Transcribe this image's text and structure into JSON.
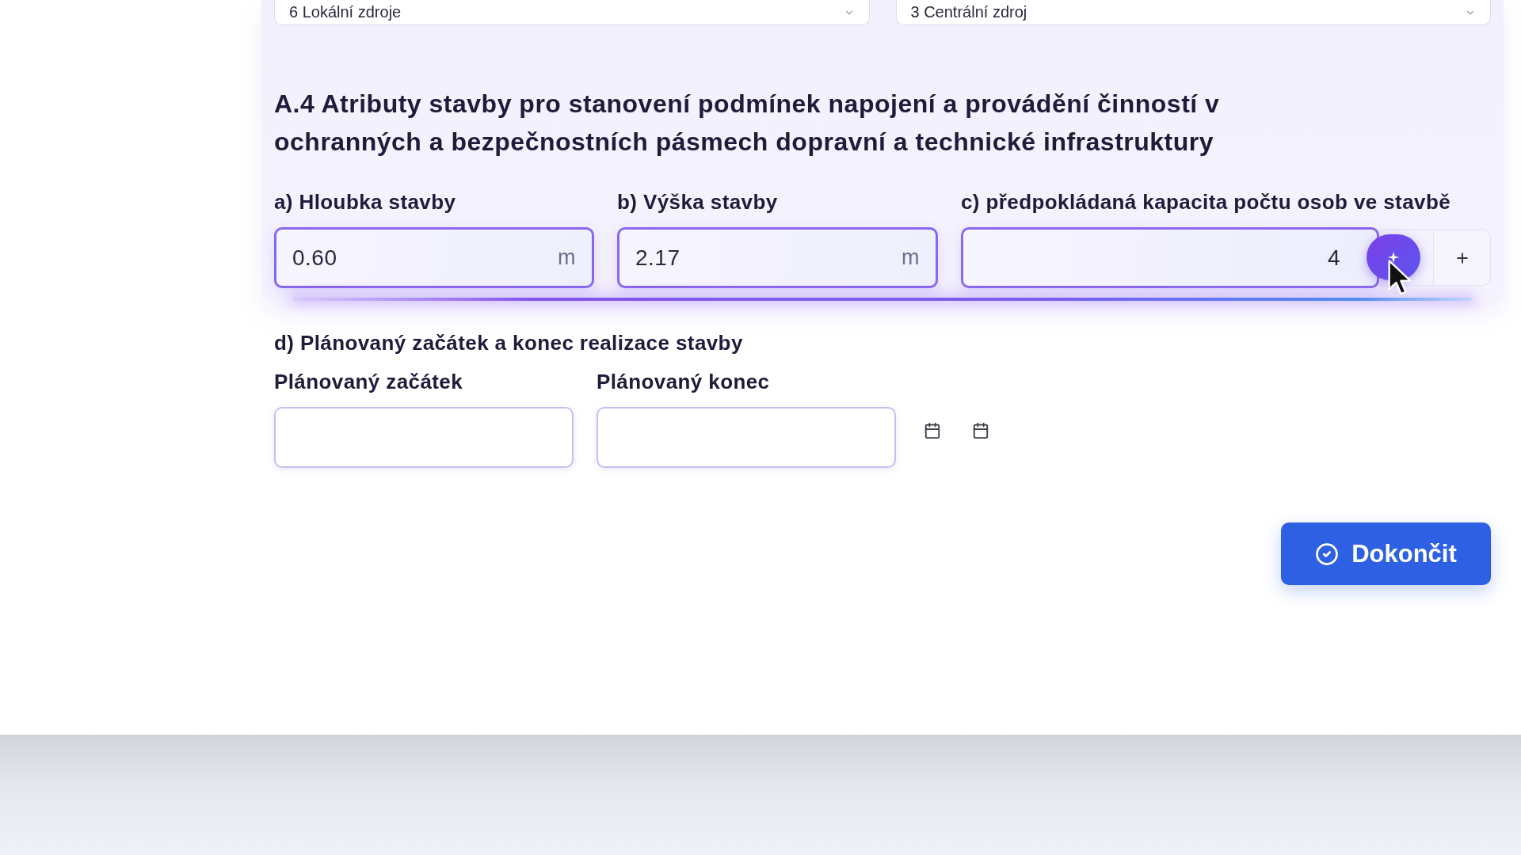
{
  "top_selects": [
    {
      "value": "6 Lokální zdroje"
    },
    {
      "value": "3 Centrální zdroj"
    }
  ],
  "section": {
    "title": "A.4 Atributy stavby pro stanovení podmínek napojení a provádění činností v ochranných a bezpečnostních pásmech dopravní a technické infrastruktury",
    "fields": [
      {
        "kind": "unit",
        "label": "a) Hloubka stavby",
        "value": "0.60",
        "unit": "m"
      },
      {
        "kind": "unit",
        "label": "b) Výška stavby",
        "value": "2.17",
        "unit": "m"
      },
      {
        "kind": "stepper",
        "label": "c) předpokládaná kapacita počtu osob ve stavbě",
        "value": "4"
      }
    ]
  },
  "dates": {
    "label": "d) Plánovaný začátek a konec realizace stavby",
    "fields": [
      {
        "label": "Plánovaný začátek"
      },
      {
        "label": "Plánovaný konec"
      }
    ]
  },
  "finish_button": {
    "label": "Dokončit"
  }
}
